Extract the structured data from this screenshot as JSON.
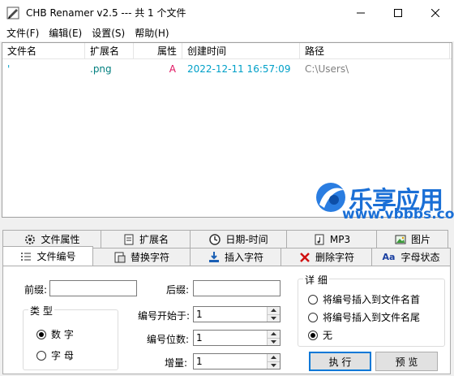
{
  "window": {
    "title": "CHB Renamer v2.5 --- 共 1 个文件"
  },
  "menu": [
    "文件(F)",
    "编辑(E)",
    "设置(S)",
    "帮助(H)"
  ],
  "list": {
    "columns": [
      "文件名",
      "扩展名",
      "属性",
      "创建时间",
      "路径"
    ],
    "rows": [
      {
        "name": "'",
        "ext": ".png",
        "attr": "A",
        "created": "2022-12-11 16:57:09",
        "path": "C:\\Users\\"
      }
    ]
  },
  "watermark": {
    "title": "乐享应用",
    "url": "www.vbbbs.com"
  },
  "tabs_row1": [
    "文件属性",
    "扩展名",
    "日期-时间",
    "MP3",
    "图片"
  ],
  "tabs_row2": [
    "文件编号",
    "替换字符",
    "插入字符",
    "删除字符",
    "字母状态"
  ],
  "panel": {
    "prefix_label": "前缀:",
    "suffix_label": "后缀:",
    "prefix_value": "",
    "suffix_value": "",
    "type_group": {
      "title": "类 型",
      "options": [
        "数 字",
        "字 母"
      ],
      "selected": 0
    },
    "start_label": "编号开始于:",
    "start_value": "1",
    "digits_label": "编号位数:",
    "digits_value": "1",
    "increment_label": "增量:",
    "increment_value": "1",
    "detail_group": {
      "title": "详 细",
      "options": [
        "将编号插入到文件名首",
        "将编号插入到文件名尾",
        "无"
      ],
      "selected": 2
    },
    "execute_label": "执 行",
    "preview_label": "预 览"
  },
  "colors": {
    "attr": "#e0115f",
    "created": "#00a0c8",
    "ext": "#007f7f",
    "path": "#808080",
    "watermark": "#1a6fd6"
  }
}
